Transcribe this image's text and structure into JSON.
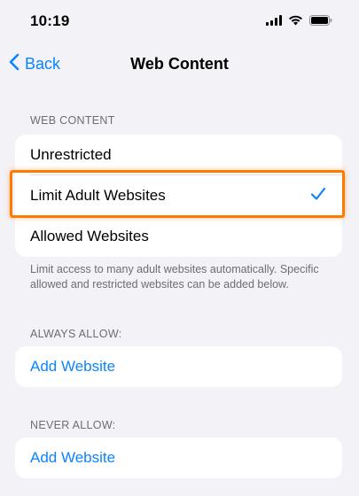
{
  "status_bar": {
    "time": "10:19"
  },
  "nav": {
    "back_label": "Back",
    "title": "Web Content"
  },
  "web_content": {
    "header": "WEB CONTENT",
    "options": [
      {
        "label": "Unrestricted",
        "selected": false
      },
      {
        "label": "Limit Adult Websites",
        "selected": true
      },
      {
        "label": "Allowed Websites",
        "selected": false
      }
    ],
    "footer": "Limit access to many adult websites automatically. Specific allowed and restricted websites can be added below."
  },
  "always_allow": {
    "header": "ALWAYS ALLOW:",
    "add_label": "Add Website"
  },
  "never_allow": {
    "header": "NEVER ALLOW:",
    "add_label": "Add Website"
  },
  "colors": {
    "accent": "#0a84ff",
    "highlight": "#ff7a00",
    "background": "#f2f2f7"
  },
  "icons": [
    "cellular-signal-icon",
    "wifi-icon",
    "battery-icon",
    "chevron-left-icon",
    "checkmark-icon"
  ]
}
